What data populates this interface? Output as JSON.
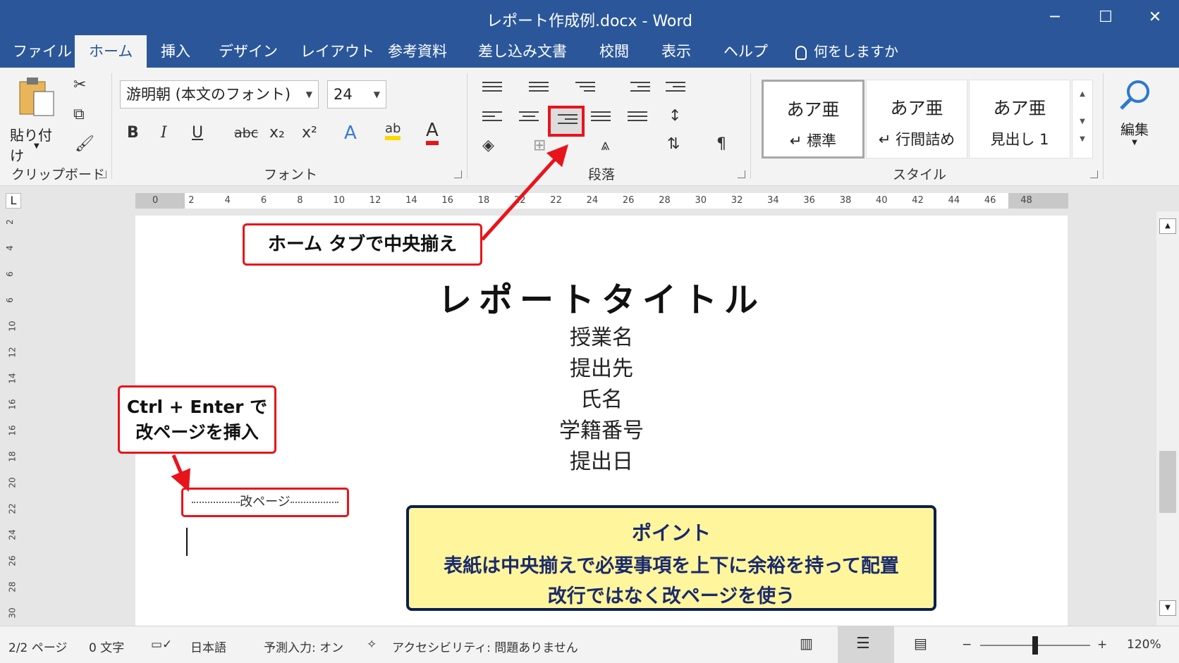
{
  "window": {
    "title": "レポート作成例.docx - Word",
    "minimize": "─",
    "maximize": "☐",
    "close": "✕"
  },
  "tabs": [
    "ファイル",
    "ホーム",
    "挿入",
    "デザイン",
    "レイアウト",
    "参考資料",
    "差し込み文書",
    "校閲",
    "表示",
    "ヘルプ"
  ],
  "tell_me": "何をしますか",
  "ribbon": {
    "clipboard": {
      "paste_label": "貼り付け",
      "group_label": "クリップボード"
    },
    "font": {
      "font_name": "游明朝 (本文のフォント)",
      "font_size": "24",
      "bold": "B",
      "italic": "I",
      "underline": "U",
      "strike": "abc",
      "subscript": "x₂",
      "superscript": "x²",
      "text_effect": "A",
      "highlight": "ab",
      "font_color": "A",
      "group_label": "フォント"
    },
    "paragraph": {
      "pilcrow": "¶",
      "group_label": "段落"
    },
    "styles": {
      "items": [
        {
          "preview": "あア亜",
          "name": "↵ 標準"
        },
        {
          "preview": "あア亜",
          "name": "↵ 行間詰め"
        },
        {
          "preview": "あア亜",
          "name": "見出し 1"
        }
      ],
      "group_label": "スタイル"
    },
    "editing_label": "編集"
  },
  "ruler": {
    "h_ticks": [
      "0",
      "2",
      "4",
      "6",
      "8",
      "10",
      "12",
      "14",
      "16",
      "18",
      "22",
      "22",
      "24",
      "26",
      "28",
      "30",
      "32",
      "34",
      "36",
      "38",
      "40",
      "42",
      "44",
      "46",
      "48"
    ],
    "v_ticks": [
      "2",
      "4",
      "6",
      "6",
      "10",
      "12",
      "14",
      "16",
      "16",
      "18",
      "20",
      "22",
      "24",
      "26",
      "28",
      "30"
    ],
    "corner": "L"
  },
  "document": {
    "title": "レポートタイトル",
    "lines": [
      "授業名",
      "提出先",
      "氏名",
      "学籍番号",
      "提出日"
    ],
    "page_break_label": "改ページ"
  },
  "callouts": {
    "home_tab": "ホーム タブで中央揃え",
    "ctrl_enter_line1": "Ctrl + Enter で",
    "ctrl_enter_line2": "改ページを挿入",
    "point_heading": "ポイント",
    "point_line1": "表紙は中央揃えで必要事項を上下に余裕を持って配置",
    "point_line2": "改行ではなく改ページを使う"
  },
  "status_bar": {
    "page": "2/2 ページ",
    "words": "0 文字",
    "language": "日本語",
    "predictive": "予測入力: オン",
    "accessibility": "アクセシビリティ: 問題ありません",
    "zoom_minus": "−",
    "zoom_plus": "+",
    "zoom": "120%"
  },
  "colors": {
    "title_bar": "#2b579a",
    "callout_border": "#e8141b",
    "point_bg": "#fff59d",
    "point_border": "#0b1f4d"
  }
}
